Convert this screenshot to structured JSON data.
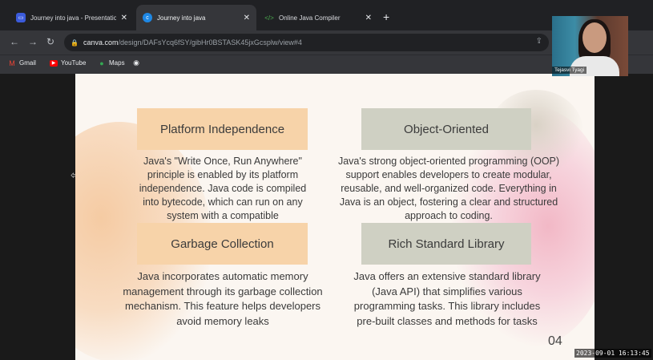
{
  "browser": {
    "tabs": [
      {
        "label": "Journey into java - Presentation",
        "icon": "canva-presentation-icon",
        "color": "#3b5bdb"
      },
      {
        "label": "Journey into java",
        "icon": "canva-icon",
        "color": "#1e88e5"
      },
      {
        "label": "Online Java Compiler",
        "icon": "code-brackets-icon",
        "color": "#2e7d32"
      }
    ],
    "close_glyph": "✕",
    "new_tab_glyph": "+",
    "url_host": "canva.com",
    "url_path": "/design/DAFsYcq6fSY/gibHr0BSTASK45jxGcsplw/view#4",
    "bookmarks": [
      "Gmail",
      "YouTube",
      "Maps"
    ]
  },
  "slide": {
    "cards": [
      {
        "title": "Platform Independence",
        "text": "Java's \"Write Once, Run Anywhere\" principle is enabled by its platform independence. Java code is compiled into bytecode, which can run on any system with a compatible"
      },
      {
        "title": "Object-Oriented",
        "text": "Java's strong object-oriented programming (OOP) support enables developers to create modular, reusable, and well-organized code. Everything in Java is an object, fostering a clear and structured approach to coding."
      },
      {
        "title": "Garbage Collection",
        "text": "Java incorporates automatic memory management through its garbage collection mechanism. This feature helps developers avoid memory leaks"
      },
      {
        "title": "Rich Standard Library",
        "text": "Java offers an extensive standard library (Java API) that simplifies various programming tasks. This library includes pre-built classes and methods for tasks"
      }
    ],
    "page_number": "04"
  },
  "webcam": {
    "name": "Tejasvi Tyagi"
  },
  "timestamp": "2023-09-01 16:13:45"
}
